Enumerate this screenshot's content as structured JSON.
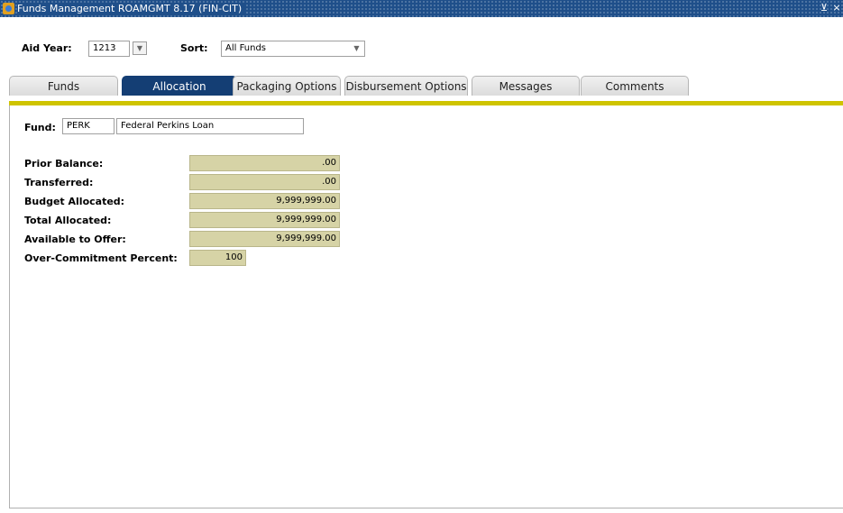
{
  "window": {
    "title": "Funds Management  ROAMGMT  8.17  (FIN-CIT)",
    "controls": [
      "⊻",
      "×"
    ]
  },
  "key_block": {
    "aid_year_label": "Aid Year:",
    "aid_year_value": "1213",
    "sort_label": "Sort:",
    "sort_value": "All Funds"
  },
  "tabs": [
    {
      "label": "Funds",
      "active": false
    },
    {
      "label": "Allocation",
      "active": true
    },
    {
      "label": "Packaging Options",
      "active": false
    },
    {
      "label": "Disbursement Options",
      "active": false
    },
    {
      "label": "Messages",
      "active": false
    },
    {
      "label": "Comments",
      "active": false
    }
  ],
  "fund": {
    "label": "Fund:",
    "code": "PERK",
    "description": "Federal Perkins Loan"
  },
  "amounts": [
    {
      "label": "Prior Balance:",
      "value": ".00"
    },
    {
      "label": "Transferred:",
      "value": ".00"
    },
    {
      "label": "Budget Allocated:",
      "value": "9,999,999.00"
    },
    {
      "label": "Total Allocated:",
      "value": "9,999,999.00"
    },
    {
      "label": "Available to Offer:",
      "value": "9,999,999.00"
    }
  ],
  "over_commitment": {
    "label": "Over-Commitment Percent:",
    "value": "100"
  },
  "colors": {
    "title_bar": "#1f4f8a",
    "active_tab": "#143e74",
    "yellow_bar": "#cfc400",
    "readonly_field": "#d6d3a6"
  }
}
